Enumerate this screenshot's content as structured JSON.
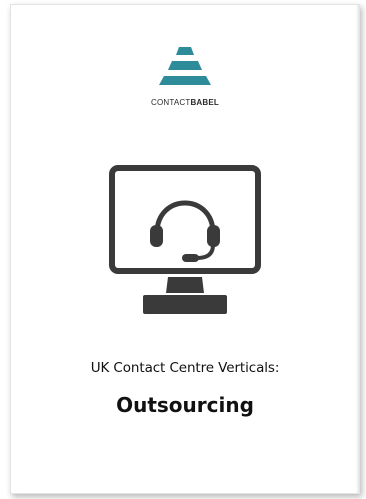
{
  "document": {
    "brand_light": "CONTACT",
    "brand_bold": "BABEL",
    "subtitle": "UK Contact Centre Verticals:",
    "title": "Outsourcing"
  },
  "colors": {
    "logo_teal": "#2e8b99",
    "icon_dark": "#3a3a3a",
    "text": "#111111"
  },
  "icons": {
    "logo": "stacked-pyramid-logo",
    "cover_illustration": "monitor-headset-icon"
  }
}
